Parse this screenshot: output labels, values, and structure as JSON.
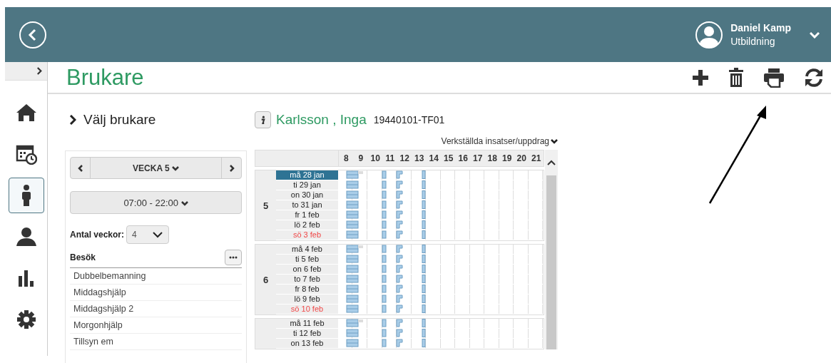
{
  "header": {
    "user": {
      "name": "Daniel Kamp",
      "role": "Utbildning"
    }
  },
  "sidebar": {
    "collapsed": true,
    "items": [
      {
        "kind": "home",
        "selected": false
      },
      {
        "kind": "calendar",
        "selected": false
      },
      {
        "kind": "person",
        "selected": true
      },
      {
        "kind": "user",
        "selected": false
      },
      {
        "kind": "chart",
        "selected": false
      },
      {
        "kind": "settings",
        "selected": false
      }
    ]
  },
  "page": {
    "title": "Brukare",
    "toolbar": [
      {
        "kind": "add"
      },
      {
        "kind": "delete"
      },
      {
        "kind": "print"
      },
      {
        "kind": "refresh"
      }
    ]
  },
  "picker": {
    "title": "Välj brukare",
    "week": "VECKA 5",
    "time_range": "07:00 - 22:00",
    "weeks_count_label": "Antal veckor:",
    "weeks_count": "4",
    "visits_title": "Besök",
    "visits": [
      "Dubbelbemanning",
      "Middagshjälp",
      "Middagshjälp 2",
      "Morgonhjälp",
      "Tillsyn em"
    ]
  },
  "client": {
    "name": "Karlsson , Inga",
    "id": "19440101-TF01",
    "filter": "Verkställda insatser/uppdrag"
  },
  "schedule": {
    "hours": [
      "8",
      "9",
      "10",
      "11",
      "12",
      "13",
      "14",
      "15",
      "16",
      "17",
      "18",
      "19",
      "20",
      "21"
    ],
    "weeks": [
      {
        "week": "5",
        "days": [
          {
            "label": "må 28 jan",
            "selected": true,
            "holiday": false
          },
          {
            "label": "ti 29 jan",
            "selected": false,
            "holiday": false
          },
          {
            "label": "on 30 jan",
            "selected": false,
            "holiday": false
          },
          {
            "label": "to 31 jan",
            "selected": false,
            "holiday": false
          },
          {
            "label": "fr 1 feb",
            "selected": false,
            "holiday": false
          },
          {
            "label": "lö 2 feb",
            "selected": false,
            "holiday": false
          },
          {
            "label": "sö 3 feb",
            "selected": false,
            "holiday": true
          }
        ]
      },
      {
        "week": "6",
        "days": [
          {
            "label": "må 4 feb",
            "selected": false,
            "holiday": false
          },
          {
            "label": "ti 5 feb",
            "selected": false,
            "holiday": false
          },
          {
            "label": "on 6 feb",
            "selected": false,
            "holiday": false
          },
          {
            "label": "to 7 feb",
            "selected": false,
            "holiday": false
          },
          {
            "label": "fr 8 feb",
            "selected": false,
            "holiday": false
          },
          {
            "label": "lö 9 feb",
            "selected": false,
            "holiday": false
          },
          {
            "label": "sö 10 feb",
            "selected": false,
            "holiday": true
          }
        ]
      },
      {
        "days": [
          {
            "label": "må 11 feb",
            "selected": false,
            "holiday": false
          },
          {
            "label": "ti 12 feb",
            "selected": false,
            "holiday": false
          },
          {
            "label": "on 13 feb",
            "selected": false,
            "holiday": false
          }
        ]
      }
    ]
  }
}
